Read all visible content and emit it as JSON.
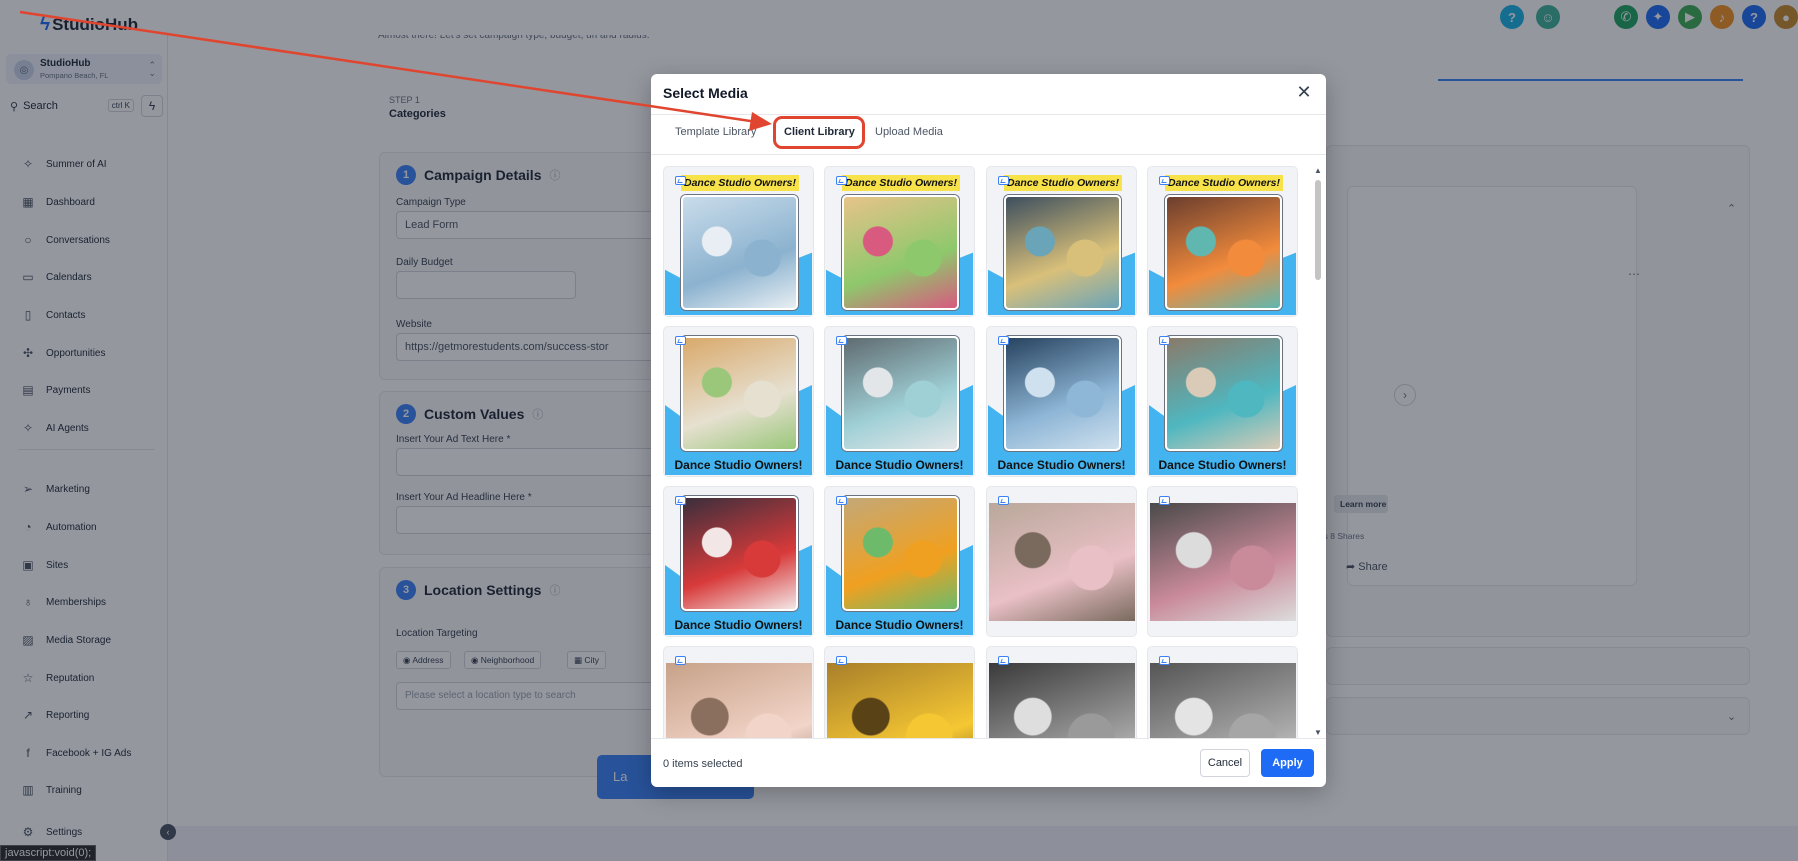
{
  "app": {
    "name": "StudioHub"
  },
  "topbar": {
    "icons": [
      {
        "name": "help-icon",
        "glyph": "?",
        "color": "#19b4e4"
      },
      {
        "name": "bot-icon",
        "glyph": "☺",
        "color": "#3fb39a"
      },
      {
        "name": "phone-icon",
        "glyph": "✆",
        "color": "#1fa463"
      },
      {
        "name": "sparkle-icon",
        "glyph": "✦",
        "color": "#1e6cf5"
      },
      {
        "name": "megaphone-icon",
        "glyph": "▶",
        "color": "#3fae55"
      },
      {
        "name": "bell-icon",
        "glyph": "♪",
        "color": "#f59222"
      },
      {
        "name": "help-icon-2",
        "glyph": "?",
        "color": "#1e6cf5"
      },
      {
        "name": "user-avatar",
        "glyph": "●",
        "color": "#c88a2c"
      }
    ]
  },
  "sidebar": {
    "account": {
      "name": "StudioHub",
      "location": "Pompano Beach, FL"
    },
    "search": {
      "placeholder": "Search",
      "shortcut": "ctrl K"
    },
    "items": [
      {
        "label": "Summer of AI",
        "icon": "sparkle-icon",
        "glyph": "✧"
      },
      {
        "label": "Dashboard",
        "icon": "dashboard-icon",
        "glyph": "▦"
      },
      {
        "label": "Conversations",
        "icon": "chat-icon",
        "glyph": "○"
      },
      {
        "label": "Calendars",
        "icon": "calendar-icon",
        "glyph": "▭"
      },
      {
        "label": "Contacts",
        "icon": "contacts-icon",
        "glyph": "▯"
      },
      {
        "label": "Opportunities",
        "icon": "opportunities-icon",
        "glyph": "✣"
      },
      {
        "label": "Payments",
        "icon": "payments-icon",
        "glyph": "▤"
      },
      {
        "label": "AI Agents",
        "icon": "ai-agents-icon",
        "glyph": "✧"
      },
      {
        "label": "Marketing",
        "icon": "send-icon",
        "glyph": "➢"
      },
      {
        "label": "Automation",
        "icon": "automation-icon",
        "glyph": "◔"
      },
      {
        "label": "Sites",
        "icon": "sites-icon",
        "glyph": "▣"
      },
      {
        "label": "Memberships",
        "icon": "award-icon",
        "glyph": "♁"
      },
      {
        "label": "Media Storage",
        "icon": "image-icon",
        "glyph": "▨"
      },
      {
        "label": "Reputation",
        "icon": "star-icon",
        "glyph": "☆"
      },
      {
        "label": "Reporting",
        "icon": "trend-icon",
        "glyph": "↗"
      },
      {
        "label": "Facebook + IG Ads",
        "icon": "facebook-icon",
        "glyph": "f"
      },
      {
        "label": "Training",
        "icon": "book-icon",
        "glyph": "▥"
      }
    ],
    "settings": "Settings",
    "status_tip": "javascript:void(0);"
  },
  "background": {
    "subtitle": "Almost there! Let's set campaign type, budget, url and radius.",
    "step_label": "STEP 1",
    "step_name": "Categories",
    "campaign_details": {
      "number": "1",
      "title": "Campaign Details",
      "campaign_type_label": "Campaign Type",
      "campaign_type_value": "Lead Form",
      "daily_budget_label": "Daily Budget",
      "website_label": "Website",
      "website_value": "https://getmorestudents.com/success-stor"
    },
    "custom_values": {
      "number": "2",
      "title": "Custom Values",
      "ad_text_label": "Insert Your Ad Text Here *",
      "ad_headline_label": "Insert Your Ad Headline Here *"
    },
    "location_settings": {
      "number": "3",
      "title": "Location Settings",
      "targeting_label": "Location Targeting",
      "chips": [
        "Address",
        "Neighborhood",
        "City"
      ],
      "search_placeholder": "Please select a location type to search"
    },
    "launch_label": "La",
    "preview": {
      "learn_more": "Learn more",
      "stats": "ements 8 Shares",
      "share": "Share"
    }
  },
  "modal": {
    "title": "Select Media",
    "tabs": [
      {
        "label": "Template Library",
        "active": false
      },
      {
        "label": "Client Library",
        "active": true
      },
      {
        "label": "Upload Media",
        "active": false
      }
    ],
    "promo_top": "Dance Studio Owners!",
    "promo_bottom": "Dance Studio Owners!",
    "footer_count": "0 items selected",
    "cancel_label": "Cancel",
    "apply_label": "Apply"
  }
}
